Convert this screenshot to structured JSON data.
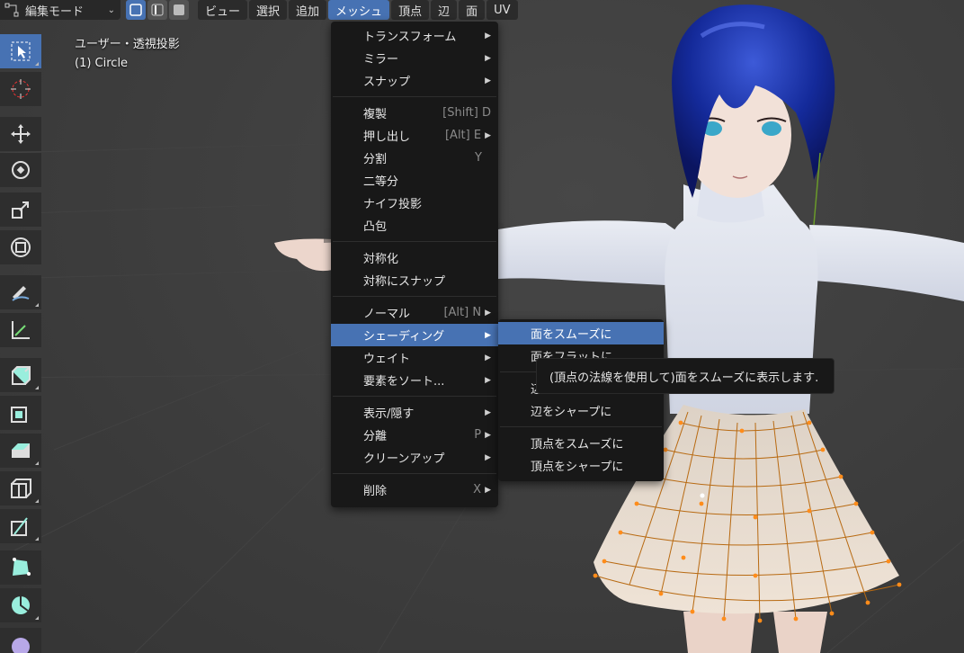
{
  "header": {
    "mode_label": "編集モード",
    "menus": [
      "ビュー",
      "選択",
      "追加",
      "メッシュ",
      "頂点",
      "辺",
      "面",
      "UV"
    ],
    "active_menu": "メッシュ"
  },
  "viewport": {
    "view_label": "ユーザー・透視投影",
    "object_label": "(1) Circle"
  },
  "mesh_menu": {
    "items": [
      {
        "label": "トランスフォーム",
        "shortcut": "",
        "submenu": true
      },
      {
        "label": "ミラー",
        "shortcut": "",
        "submenu": true
      },
      {
        "label": "スナップ",
        "shortcut": "",
        "submenu": true
      },
      {
        "label": "複製",
        "shortcut": "[Shift] D",
        "submenu": false
      },
      {
        "label": "押し出し",
        "shortcut": "[Alt] E",
        "submenu": true
      },
      {
        "label": "分割",
        "shortcut": "Y",
        "submenu": false
      },
      {
        "label": "二等分",
        "shortcut": "",
        "submenu": false
      },
      {
        "label": "ナイフ投影",
        "shortcut": "",
        "submenu": false
      },
      {
        "label": "凸包",
        "shortcut": "",
        "submenu": false
      },
      {
        "label": "対称化",
        "shortcut": "",
        "submenu": false
      },
      {
        "label": "対称にスナップ",
        "shortcut": "",
        "submenu": false
      },
      {
        "label": "ノーマル",
        "shortcut": "[Alt] N",
        "submenu": true
      },
      {
        "label": "シェーディング",
        "shortcut": "",
        "submenu": true
      },
      {
        "label": "ウェイト",
        "shortcut": "",
        "submenu": true
      },
      {
        "label": "要素をソート...",
        "shortcut": "",
        "submenu": true
      },
      {
        "label": "表示/隠す",
        "shortcut": "",
        "submenu": true
      },
      {
        "label": "分離",
        "shortcut": "P",
        "submenu": true
      },
      {
        "label": "クリーンアップ",
        "shortcut": "",
        "submenu": true
      },
      {
        "label": "削除",
        "shortcut": "X",
        "submenu": true
      }
    ]
  },
  "shading_menu": {
    "items": [
      {
        "label": "面をスムーズに"
      },
      {
        "label": "面をフラットに"
      },
      {
        "label": "辺をスムーズに"
      },
      {
        "label": "辺をシャープに"
      },
      {
        "label": "頂点をスムーズに"
      },
      {
        "label": "頂点をシャープに"
      }
    ]
  },
  "tooltip": {
    "text": "(頂点の法線を使用して)面をスムーズに表示します."
  },
  "toolbar": {
    "tools": [
      "select-box-icon",
      "cursor-icon",
      "move-icon",
      "rotate-icon",
      "scale-icon",
      "transform-icon",
      "annotate-icon",
      "measure-icon",
      "extrude-icon",
      "inset-icon",
      "bevel-icon",
      "loop-cut-icon",
      "knife-icon",
      "poly-build-icon",
      "spin-icon",
      "smooth-icon"
    ]
  },
  "colors": {
    "accent": "#4772b3",
    "menu_bg": "#181818",
    "vertex_orange": "#ff8c1a",
    "hair": "#1a2fa8"
  }
}
